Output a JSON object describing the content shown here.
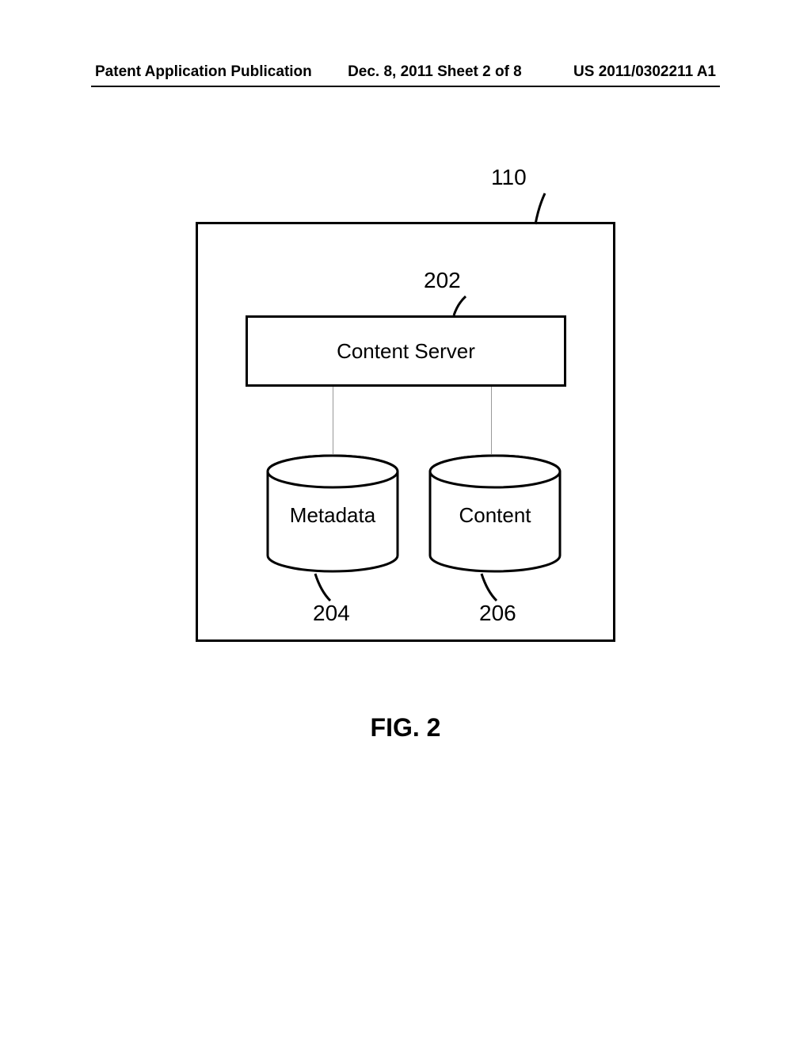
{
  "header": {
    "left": "Patent Application Publication",
    "center": "Dec. 8, 2011  Sheet 2 of 8",
    "right": "US 2011/0302211 A1"
  },
  "diagram": {
    "ref_system": "110",
    "ref_server": "202",
    "server_label": "Content Server",
    "metadata_label": "Metadata",
    "content_label": "Content",
    "ref_metadata": "204",
    "ref_content": "206"
  },
  "caption": "FIG. 2"
}
